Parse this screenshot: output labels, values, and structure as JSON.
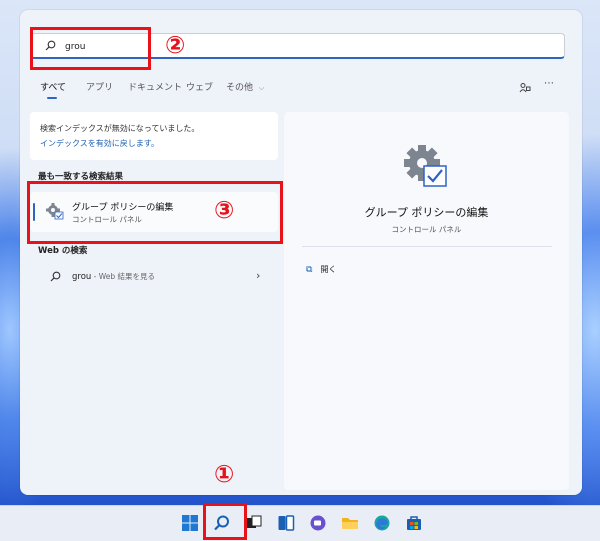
{
  "search": {
    "query": "grou"
  },
  "tabs": [
    "すべて",
    "アプリ",
    "ドキュメント",
    "ウェブ",
    "その他"
  ],
  "more_icon": "⋯",
  "notice": {
    "line1": "検索インデックスが無効になっていました。",
    "line2": "インデックスを有効に戻します。"
  },
  "best_match": {
    "heading": "最も一致する検索結果",
    "title": "グループ ポリシーの編集",
    "subtitle": "コントロール パネル"
  },
  "web": {
    "heading": "Web の検索",
    "query": "grou",
    "suffix": " - Web 結果を見る"
  },
  "detail": {
    "title": "グループ ポリシーの編集",
    "subtitle": "コントロール パネル",
    "open_label": "開く"
  },
  "annotations": [
    "①",
    "②",
    "③"
  ],
  "colors": {
    "accent": "#2f64c7",
    "annotation": "#e8121b",
    "link": "#1a5fb4"
  },
  "taskbar_icons": [
    "windows-start-icon",
    "search-icon",
    "task-view-icon",
    "widgets-icon",
    "chat-icon",
    "file-explorer-icon",
    "edge-icon",
    "store-icon"
  ]
}
